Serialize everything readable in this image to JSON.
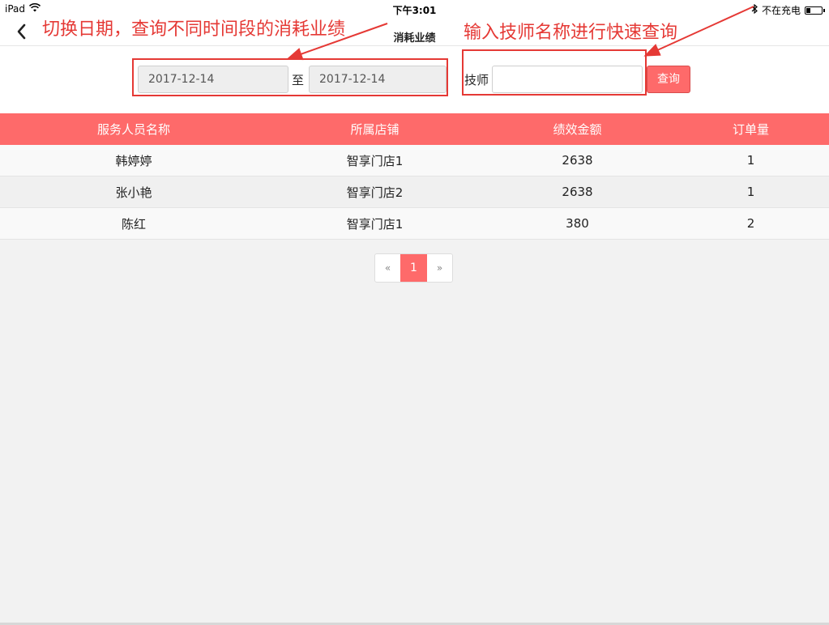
{
  "status_bar": {
    "device": "iPad",
    "time": "下午3:01",
    "charging": "不在充电",
    "wifi_icon": "wifi-icon",
    "bluetooth_icon": "bluetooth-icon",
    "battery_icon": "battery-icon"
  },
  "nav": {
    "title": "消耗业绩",
    "back_icon": "chevron-left-icon"
  },
  "filter": {
    "date_from": "2017-12-14",
    "to_label": "至",
    "date_to": "2017-12-14",
    "tech_label": "技师",
    "tech_value": "",
    "query_label": "查询"
  },
  "annotations": {
    "date_note": "切换日期，查询不同时间段的消耗业绩",
    "search_note": "输入技师名称进行快速查询",
    "color": "#e53935"
  },
  "table": {
    "headers": [
      "服务人员名称",
      "所属店铺",
      "绩效金额",
      "订单量"
    ],
    "rows": [
      [
        "韩婷婷",
        "智享门店1",
        "2638",
        "1"
      ],
      [
        "张小艳",
        "智享门店2",
        "2638",
        "1"
      ],
      [
        "陈红",
        "智享门店1",
        "380",
        "2"
      ]
    ]
  },
  "pagination": {
    "prev": "«",
    "pages": [
      "1"
    ],
    "current": "1",
    "next": "»"
  },
  "colors": {
    "accent": "#fe6a6a",
    "background": "#f2f2f2"
  }
}
